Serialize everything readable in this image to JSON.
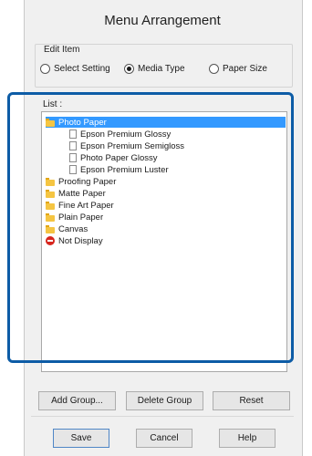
{
  "dialog": {
    "title": "Menu Arrangement"
  },
  "edit_item": {
    "label": "Edit Item",
    "options": [
      {
        "label": "Select Setting",
        "checked": false
      },
      {
        "label": "Media Type",
        "checked": true
      },
      {
        "label": "Paper Size",
        "checked": false
      }
    ]
  },
  "list": {
    "label": "List :",
    "items": [
      {
        "label": "Photo Paper",
        "icon": "folder-icon",
        "level": 0,
        "selected": true
      },
      {
        "label": "Epson Premium Glossy",
        "icon": "document-icon",
        "level": 1,
        "selected": false
      },
      {
        "label": "Epson Premium Semigloss",
        "icon": "document-icon",
        "level": 1,
        "selected": false
      },
      {
        "label": "Photo Paper Glossy",
        "icon": "document-icon",
        "level": 1,
        "selected": false
      },
      {
        "label": "Epson Premium Luster",
        "icon": "document-icon",
        "level": 1,
        "selected": false
      },
      {
        "label": "Proofing Paper",
        "icon": "folder-icon",
        "level": 0,
        "selected": false
      },
      {
        "label": "Matte Paper",
        "icon": "folder-icon",
        "level": 0,
        "selected": false
      },
      {
        "label": "Fine Art Paper",
        "icon": "folder-icon",
        "level": 0,
        "selected": false
      },
      {
        "label": "Plain Paper",
        "icon": "folder-icon",
        "level": 0,
        "selected": false
      },
      {
        "label": "Canvas",
        "icon": "folder-icon",
        "level": 0,
        "selected": false
      },
      {
        "label": "Not Display",
        "icon": "no-entry-icon",
        "level": 0,
        "selected": false
      }
    ]
  },
  "buttons": {
    "add_group": "Add Group...",
    "delete_group": "Delete Group",
    "reset": "Reset",
    "save": "Save",
    "cancel": "Cancel",
    "help": "Help"
  },
  "colors": {
    "selection": "#3399ff",
    "highlight_frame": "#0d5ca6"
  }
}
